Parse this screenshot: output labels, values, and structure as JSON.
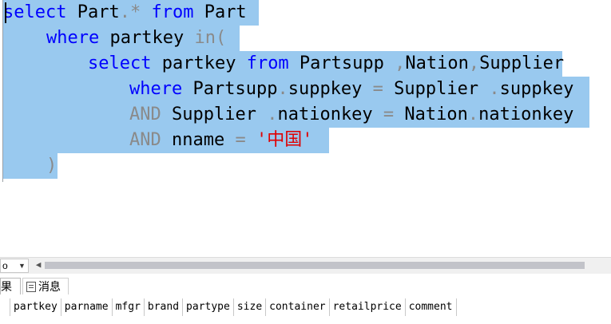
{
  "editor": {
    "lines": [
      {
        "parts": [
          {
            "cls": "kw",
            "text": "select"
          },
          {
            "cls": "tx",
            "text": " Part"
          },
          {
            "cls": "gr",
            "text": ".*"
          },
          {
            "cls": "kw",
            "text": " from"
          },
          {
            "cls": "tx",
            "text": " Part"
          }
        ]
      },
      {
        "parts": [
          {
            "cls": "kw",
            "text": "where"
          },
          {
            "cls": "tx",
            "text": " partkey"
          },
          {
            "cls": "gr",
            "text": " in("
          }
        ]
      },
      {
        "parts": [
          {
            "cls": "kw",
            "text": "select"
          },
          {
            "cls": "tx",
            "text": " partkey"
          },
          {
            "cls": "kw",
            "text": " from"
          },
          {
            "cls": "tx",
            "text": " Partsupp"
          },
          {
            "cls": "gr",
            "text": " ,"
          },
          {
            "cls": "tx",
            "text": "Nation"
          },
          {
            "cls": "gr",
            "text": ","
          },
          {
            "cls": "tx",
            "text": "Supplier"
          }
        ]
      },
      {
        "parts": [
          {
            "cls": "kw",
            "text": "where"
          },
          {
            "cls": "tx",
            "text": " Partsupp"
          },
          {
            "cls": "gr",
            "text": "."
          },
          {
            "cls": "tx",
            "text": "suppkey"
          },
          {
            "cls": "gr",
            "text": " ="
          },
          {
            "cls": "tx",
            "text": " Supplier"
          },
          {
            "cls": "gr",
            "text": " ."
          },
          {
            "cls": "tx",
            "text": "suppkey"
          }
        ]
      },
      {
        "parts": [
          {
            "cls": "gr",
            "text": "AND"
          },
          {
            "cls": "tx",
            "text": " Supplier"
          },
          {
            "cls": "gr",
            "text": " ."
          },
          {
            "cls": "tx",
            "text": "nationkey"
          },
          {
            "cls": "gr",
            "text": " ="
          },
          {
            "cls": "tx",
            "text": " Nation"
          },
          {
            "cls": "gr",
            "text": "."
          },
          {
            "cls": "tx",
            "text": "nationkey"
          }
        ]
      },
      {
        "parts": [
          {
            "cls": "gr",
            "text": "AND"
          },
          {
            "cls": "tx",
            "text": " nname"
          },
          {
            "cls": "gr",
            "text": " ="
          },
          {
            "cls": "str",
            "text": " '中国'"
          }
        ]
      },
      {
        "parts": [
          {
            "cls": "gr",
            "text": ")"
          }
        ]
      }
    ]
  },
  "zoom": {
    "value": "o"
  },
  "tabs": {
    "results": "果",
    "messages": "消息"
  },
  "results": {
    "columns": [
      "partkey",
      "parname",
      "mfgr",
      "brand",
      "partype",
      "size",
      "container",
      "retailprice",
      "comment"
    ]
  }
}
